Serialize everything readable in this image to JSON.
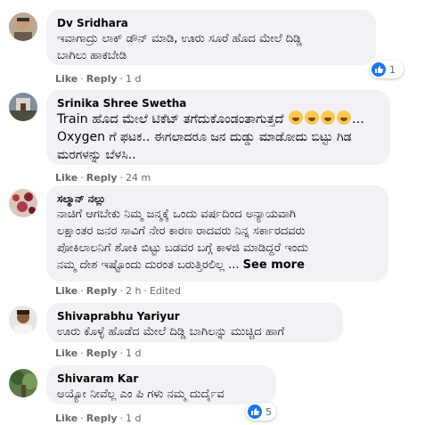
{
  "comments": [
    {
      "author": "Dv Sridhara",
      "text": "ಇವಾಗಾದ್ರು ಲಾಕ್ ಡೌನ್ ಮಾಡಿ, ಊರು ಸೂರೆ ಹೊದ ಮೇಲೆ ದಿಡ್ಡಿ\nಬಾಗಿಲು ಹಾಕಬೇಡಿ",
      "like": "Like",
      "reply": "Reply",
      "time": "1 d",
      "reaction_count": "1",
      "reaction_icon": "like-icon"
    },
    {
      "author": "Srinika Shree Swetha",
      "text_line1": "Train ಹೊದ ಮೇಲೆ ಟಿಕೆಟ್ ತಗೆದುಕೊಂಡಂತಾಗುತ್ತದೆ",
      "text_line1_tail": "...",
      "text_rest": "Oxygen ಗೆ ಫಟಕ.. ಈಗಲಾದರೂ ಜನ ದುಡ್ಡು ಮಾಡೋದು ಬಿಟ್ಟು ಗಿಡ\nಮರಗಳನ್ನು ಬೆಳಸಿ..",
      "like": "Like",
      "reply": "Reply",
      "time": "24 m"
    },
    {
      "author": "ಸಲ್ಮಾನ್ ನಲ್ಲು",
      "text": "ನಾಚಿಗೆ ಆಗಬೇಕು ನಿಮ್ಮ ಜನ್ಮಕ್ಕೆ ಒಂದು ವರ್ಷದಿಂದ ಅನ್ಯಾಯವಾಗಿ\nಲಕ್ಷಾಂತರ ಜನರ ಸಾವಿಗೆ ನೇರ ಕಾರಣ ರಾದವರು ನಿನ್ನ ಸರ್ಕಾರದವರು\nಪೋಕಿಲಾಲನಿಗೆ ಶೋಕಿ ಬಿಟ್ಟು ಬಡವರ ಬಗ್ಗೆ ಕಾಳಜಿ ಮಾಡಿದ್ದರೆ ಇಂದು\nನಮ್ಮ ದೇಶ ಇಷ್ಟೊಂದು ದುರಂತ ಬರುತ್ತಿರಲಿಲ್ಲ ...",
      "see_more": "See more",
      "like": "Like",
      "reply": "Reply",
      "time": "2 h",
      "edited": "Edited"
    },
    {
      "author": "Shivaprabhu Yariyur",
      "text": "ಊರು ಕೊಳ್ಳೆ ಹೊಡೆದ ಮೇಲೆ ದಿಡ್ಡಿ ಬಾಗಿಲನ್ನು ಮುಚ್ಚಿದ ಹಾಗೆ",
      "like": "Like",
      "reply": "Reply",
      "time": "1 d"
    },
    {
      "author": "Shivaram Kar",
      "text": "ಅಯ್ಯೋ ನೀವೆಲ್ಲ ಎಂ ಪಿ ಗಳು ನಮ್ಮ ದುರ್ದೈವ",
      "like": "Like",
      "reply": "Reply",
      "time": "1 d",
      "reaction_count": "5",
      "reaction_icon": "like-icon"
    }
  ],
  "colors": {
    "bubble": "#f0f2f5",
    "meta": "#65676b",
    "like_blue": "#1877f2"
  }
}
